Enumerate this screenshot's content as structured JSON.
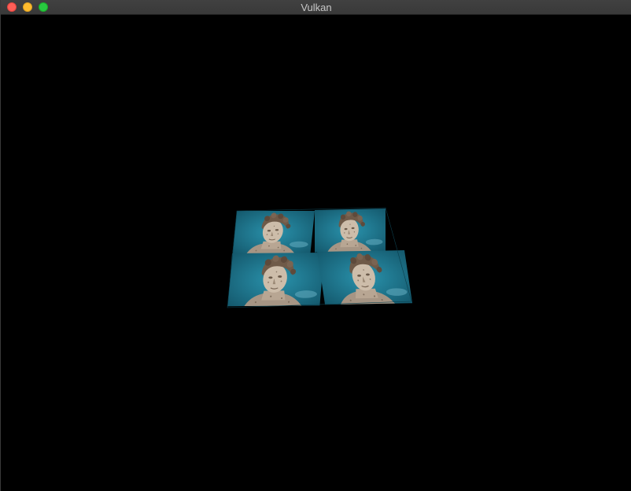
{
  "window": {
    "title": "Vulkan"
  },
  "scene": {
    "background_color": "#000000",
    "texture_tiles": 4,
    "texture_sky_color": "#1f7f96",
    "texture_statue_color": "#c9b9a6"
  }
}
